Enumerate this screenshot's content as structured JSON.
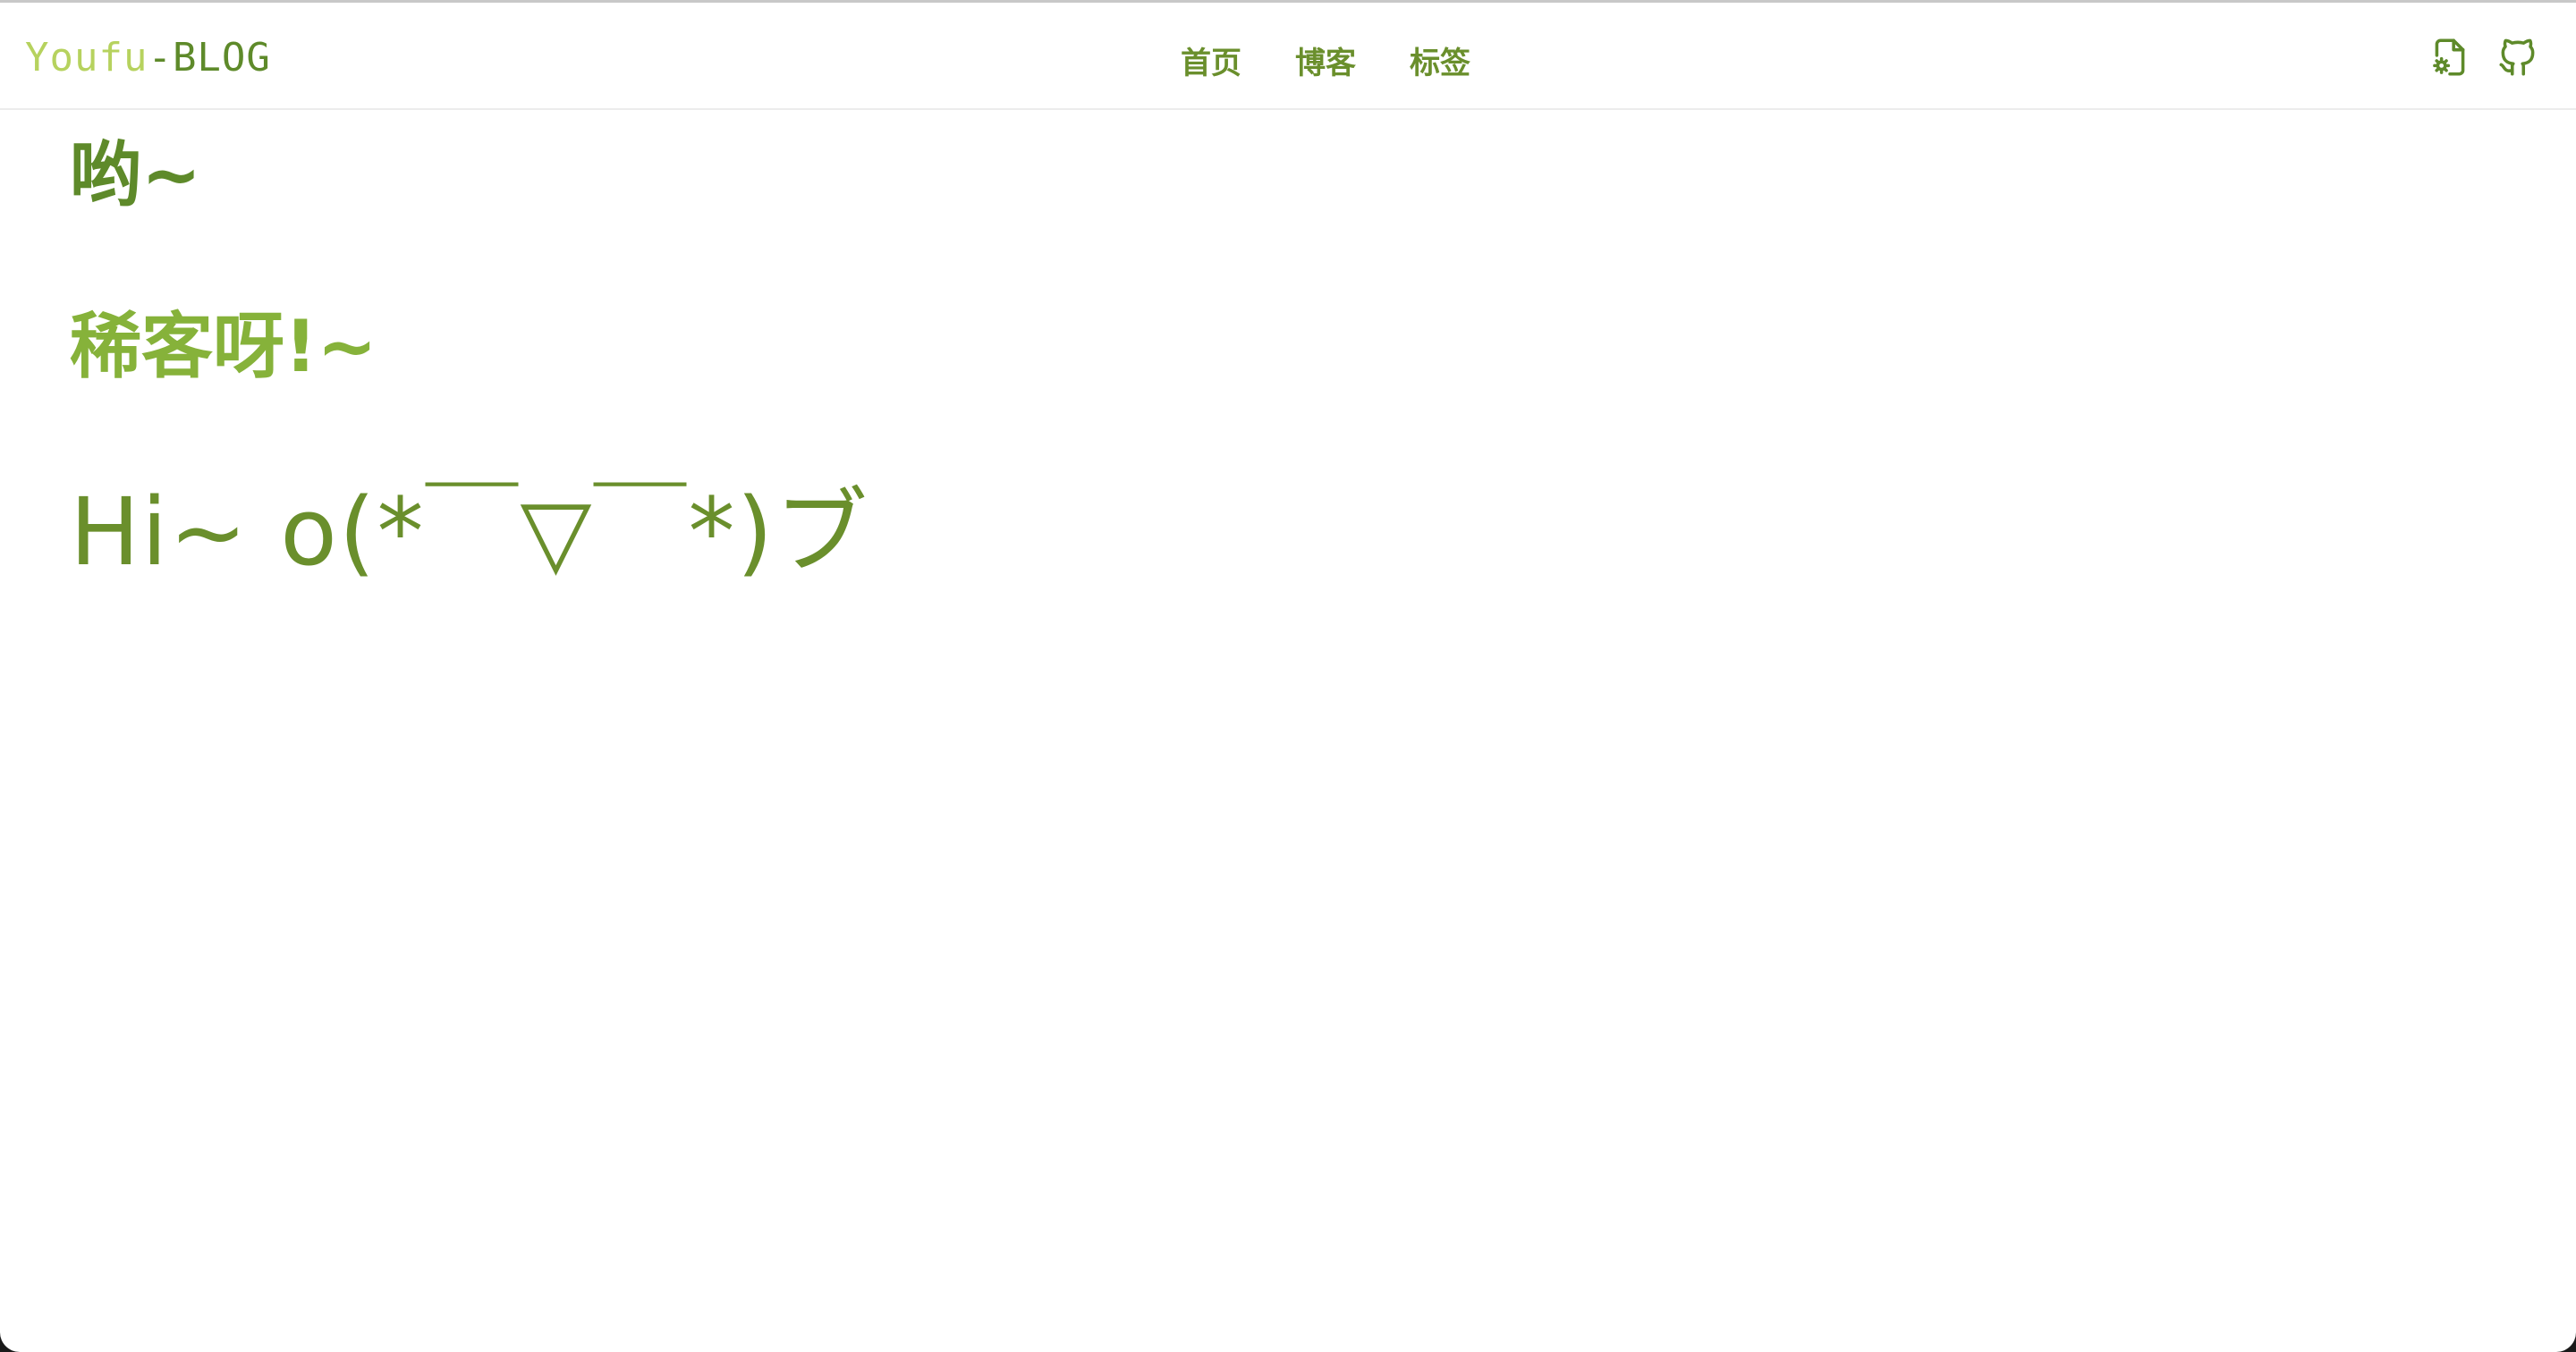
{
  "navbar": {
    "brand_part1": "Youfu",
    "brand_part2": "-BLOG",
    "links": [
      {
        "label": "首页"
      },
      {
        "label": "博客"
      },
      {
        "label": "标签"
      }
    ],
    "icons": [
      "file-settings-icon",
      "github-icon"
    ]
  },
  "main": {
    "greeting": "哟~",
    "subgreeting": "稀客呀!~",
    "hello": "Hi~ o(*￣▽￣*)ブ"
  },
  "colors": {
    "brand_light": "#b6d25e",
    "brand_dark": "#5e8a2a",
    "accent": "#6a8f2c",
    "accent_light": "#86b23a",
    "background": "#ffffff"
  }
}
